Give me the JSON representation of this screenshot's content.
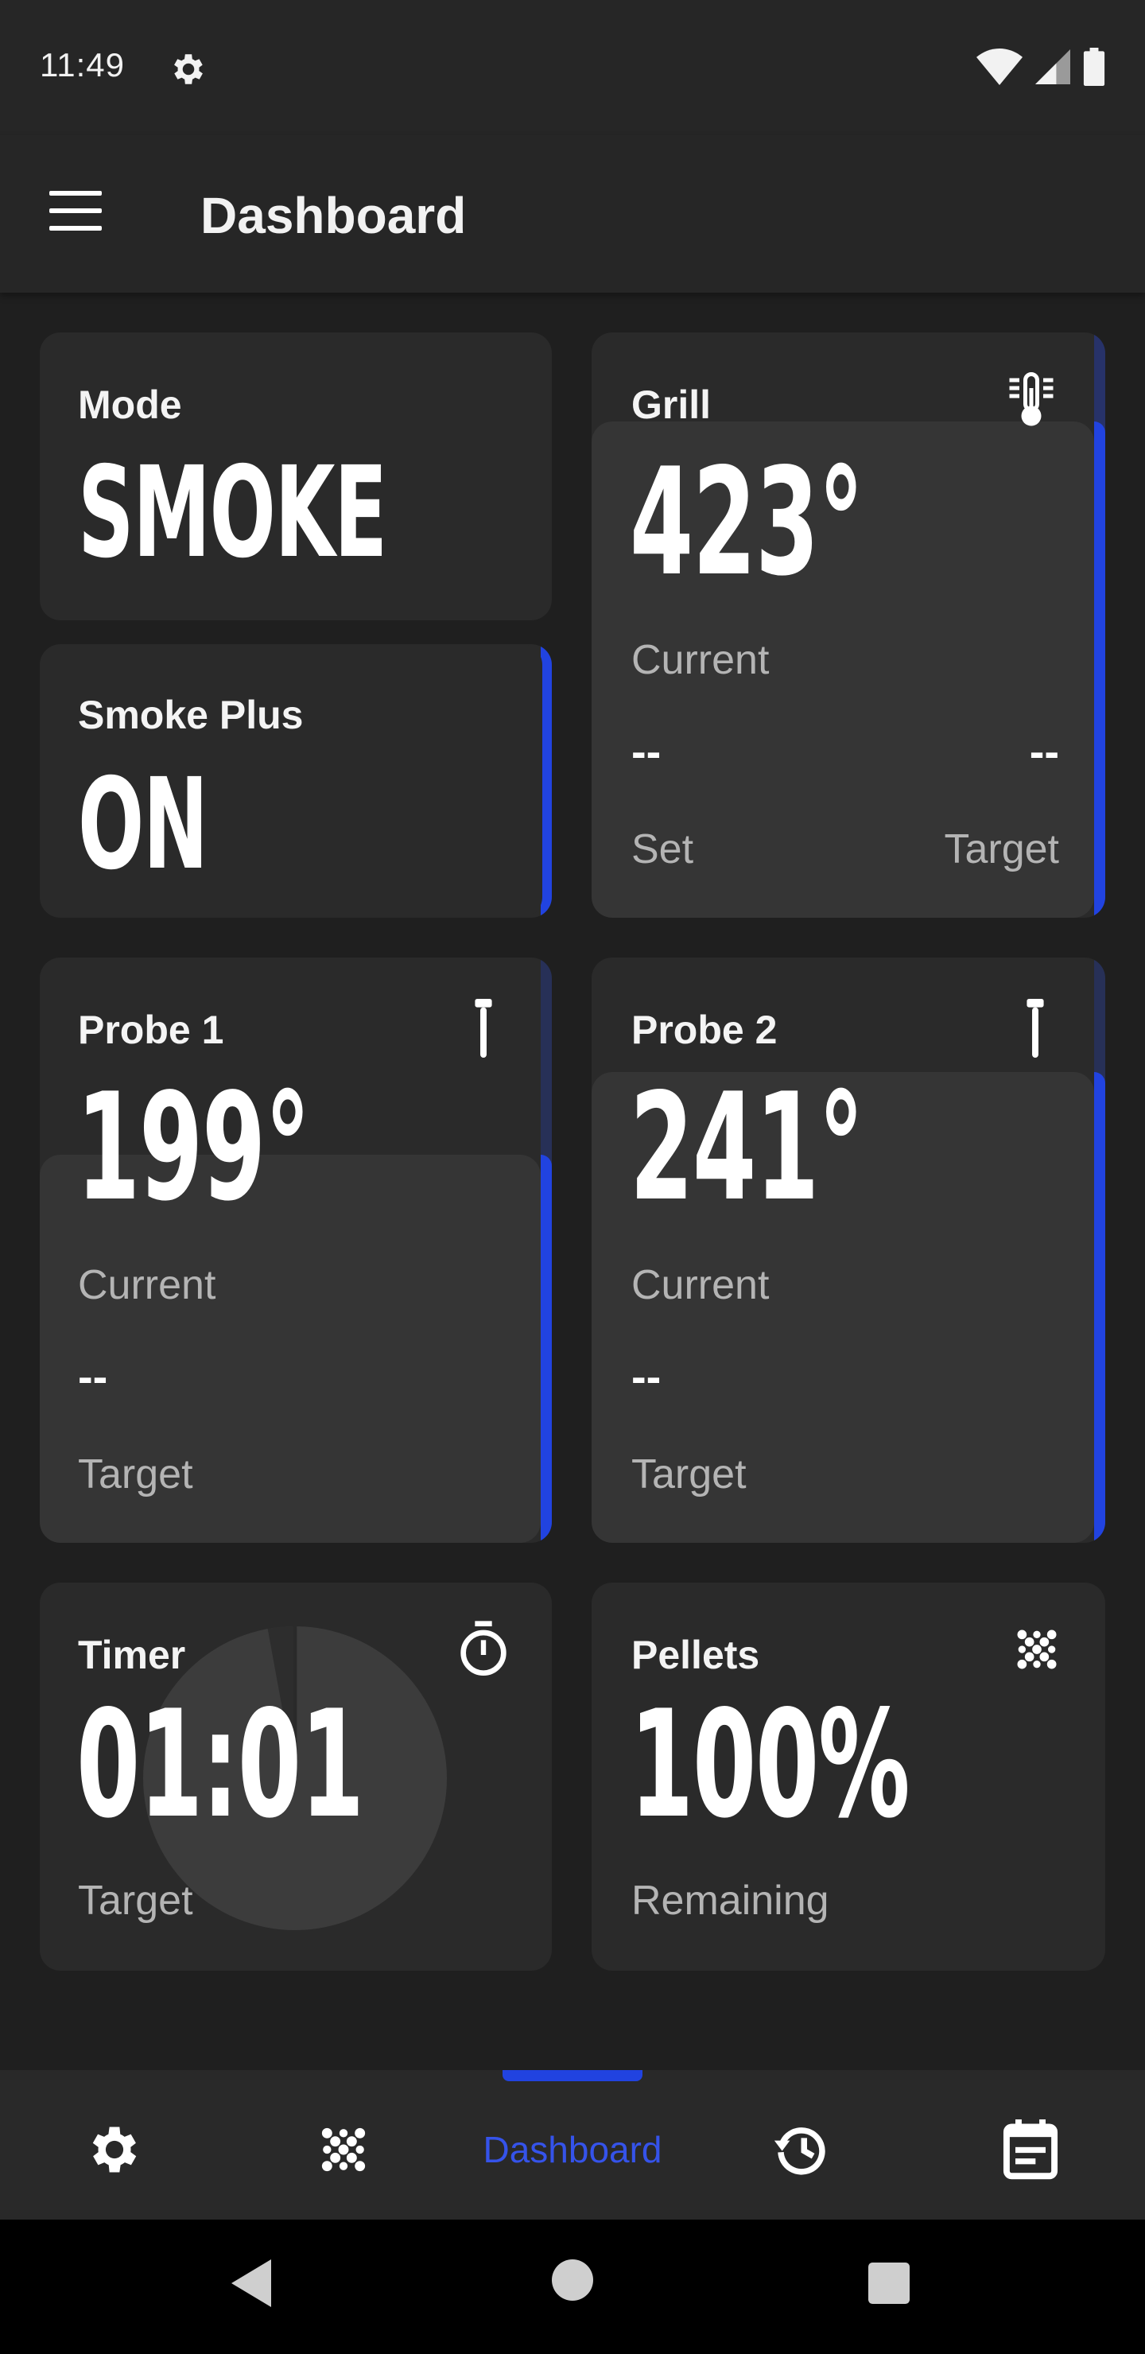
{
  "status_bar": {
    "time": "11:49"
  },
  "app_bar": {
    "title": "Dashboard"
  },
  "cards": {
    "mode": {
      "label": "Mode",
      "value": "SMOKE"
    },
    "smoke_plus": {
      "label": "Smoke Plus",
      "value": "ON"
    },
    "grill": {
      "label": "Grill",
      "value": "423°",
      "current_label": "Current",
      "set_value": "--",
      "target_value": "--",
      "set_label": "Set",
      "target_label": "Target"
    },
    "probe1": {
      "label": "Probe 1",
      "value": "199°",
      "current_label": "Current",
      "target_value": "--",
      "target_label": "Target"
    },
    "probe2": {
      "label": "Probe 2",
      "value": "241°",
      "current_label": "Current",
      "target_value": "--",
      "target_label": "Target"
    },
    "timer": {
      "label": "Timer",
      "value": "01:01",
      "target_label": "Target"
    },
    "pellets": {
      "label": "Pellets",
      "value": "100%",
      "remaining_label": "Remaining"
    }
  },
  "bottom_nav": {
    "items": [
      {
        "icon": "settings-icon"
      },
      {
        "icon": "pellets-icon"
      },
      {
        "label": "Dashboard",
        "active": true
      },
      {
        "icon": "history-icon"
      },
      {
        "icon": "events-icon"
      }
    ]
  },
  "colors": {
    "accent": "#2143e0",
    "background": "#1f1f1f",
    "card": "#2a2a2a",
    "card_inner": "#353535"
  }
}
